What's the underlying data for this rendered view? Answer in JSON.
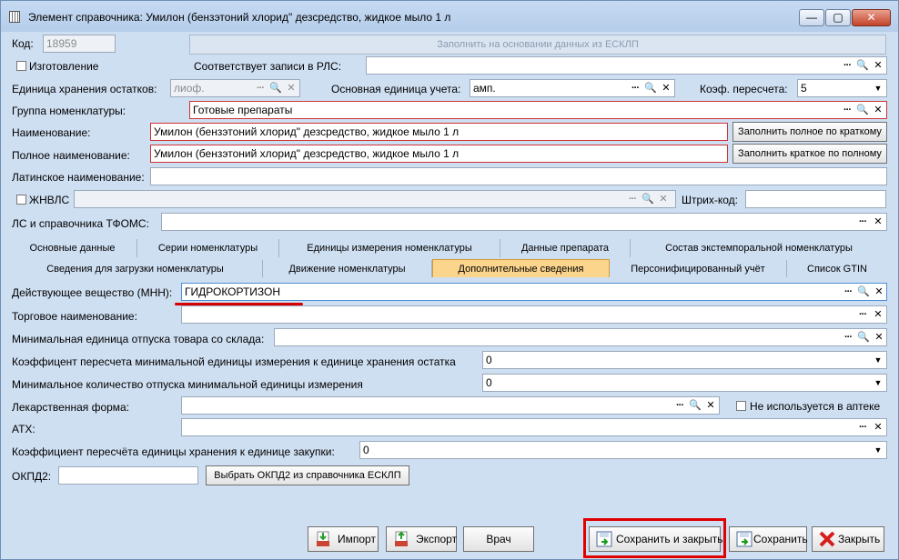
{
  "window": {
    "title": "Элемент справочника: Умилон (бензэтоний хлорид\" дезсредство, жидкое мыло 1 л",
    "btn_min": "—",
    "btn_max": "▢",
    "btn_close": "✕"
  },
  "icons": {
    "dots": "···",
    "search": "🔍",
    "clear": "✕",
    "dropdown": "▼"
  },
  "header": {
    "code_label": "Код:",
    "code_value": "18959",
    "fill_esklp_button": "Заполнить на основании данных из ЕСКЛП",
    "manufacturing_label": "Изготовление",
    "rls_label": "Соответствует записи в РЛС:",
    "rls_value": "",
    "storage_unit_label": "Единица хранения остатков:",
    "storage_unit_value": "лиоф.",
    "base_unit_label": "Основная единица учета:",
    "base_unit_value": "амп.",
    "coef_label": "Коэф. пересчета:",
    "coef_value": "5",
    "group_label": "Группа номенклатуры:",
    "group_value": "Готовые препараты",
    "name_label": "Наименование:",
    "name_value": "Умилон (бензэтоний хлорид\" дезсредство, жидкое мыло 1 л",
    "fill_full_button": "Заполнить полное по краткому",
    "full_name_label": "Полное наименование:",
    "full_name_value": "Умилон (бензэтоний хлорид\" дезсредство, жидкое мыло 1 л",
    "fill_short_button": "Заполнить краткое по полному",
    "latin_label": "Латинское наименование:",
    "latin_value": "",
    "zhnvls_label": "ЖНВЛС",
    "zhnvls_value": "",
    "barcode_label": "Штрих-код:",
    "barcode_value": "",
    "tfoms_label": "ЛС и справочника ТФОМС:",
    "tfoms_value": ""
  },
  "tabs_row1": [
    "Основные данные",
    "Серии номенклатуры",
    "Единицы измерения номенклатуры",
    "Данные препарата",
    "Состав экстемпоральной номенклатуры"
  ],
  "tabs_row2": [
    "Сведения для загрузки номенклатуры",
    "Движение номенклатуры",
    "Дополнительные сведения",
    "Персонифицированный учёт",
    "Список GTIN"
  ],
  "active_tab": "Дополнительные сведения",
  "details": {
    "mnn_label": "Действующее вещество (МНН):",
    "mnn_value": "ГИДРОКОРТИЗОН",
    "trade_label": "Торговое наименование:",
    "trade_value": "",
    "min_unit_label": "Минимальная единица отпуска товара со склада:",
    "min_unit_value": "",
    "coef_min_label": "Коэффицент пересчета минимальной единицы измерения к единице хранения остатка",
    "coef_min_value": "0",
    "min_qty_label": "Минимальное количество отпуска минимальной единицы измерения",
    "min_qty_value": "0",
    "form_label": "Лекарственная форма:",
    "form_value": "",
    "not_used_label": "Не используется в аптеке",
    "atc_label": "АТХ:",
    "atc_value": "",
    "purchase_coef_label": "Коэффициент пересчёта единицы хранения к единице закупки:",
    "purchase_coef_value": "0",
    "okpd2_label": "ОКПД2:",
    "okpd2_value": "",
    "okpd2_button": "Выбрать ОКПД2 из справочника ЕСКЛП"
  },
  "footer": {
    "import_button": "Импорт",
    "export_button": "Экспорт",
    "doctor_button": "Врач",
    "save_close_button": "Сохранить и закрыть",
    "save_button": "Сохранить",
    "close_button": "Закрыть"
  }
}
